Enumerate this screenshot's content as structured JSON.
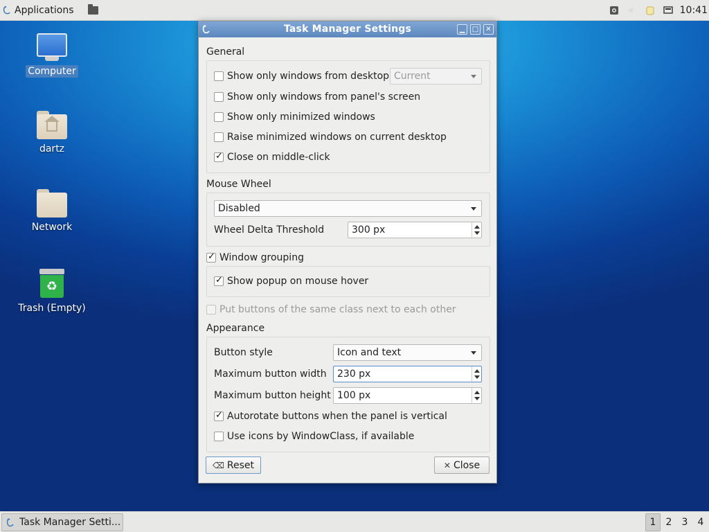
{
  "top_panel": {
    "applications_label": "Applications",
    "clock": "10:41"
  },
  "desktop": {
    "icons": [
      {
        "label": "Computer",
        "icon": "computer-icon",
        "selected": true
      },
      {
        "label": "dartz",
        "icon": "home-folder-icon"
      },
      {
        "label": "Network",
        "icon": "folder-icon"
      },
      {
        "label": "Trash (Empty)",
        "icon": "trash-icon"
      }
    ]
  },
  "dialog": {
    "title": "Task Manager Settings",
    "general": {
      "heading": "General",
      "show_windows_desktop": {
        "label": "Show only windows from desktop",
        "checked": false
      },
      "desktop_combo": "Current",
      "show_windows_screen": {
        "label": "Show only windows from panel's screen",
        "checked": false
      },
      "show_minimized": {
        "label": "Show only minimized windows",
        "checked": false
      },
      "raise_minimized": {
        "label": "Raise minimized windows on current desktop",
        "checked": false
      },
      "close_middle_click": {
        "label": "Close on middle-click",
        "checked": true
      }
    },
    "mouse_wheel": {
      "heading": "Mouse Wheel",
      "mode": "Disabled",
      "threshold_label": "Wheel Delta Threshold",
      "threshold_value": "300 px"
    },
    "window_grouping": {
      "label": "Window grouping",
      "checked": true,
      "popup_hover": {
        "label": "Show popup on mouse hover",
        "checked": true
      }
    },
    "same_class": {
      "label": "Put buttons of the same class next to each other",
      "checked": false,
      "disabled": true
    },
    "appearance": {
      "heading": "Appearance",
      "button_style_label": "Button style",
      "button_style_value": "Icon and text",
      "max_width_label": "Maximum button width",
      "max_width_value": "230 px",
      "max_height_label": "Maximum button height",
      "max_height_value": "100 px",
      "autorotate": {
        "label": "Autorotate buttons when the panel is vertical",
        "checked": true
      },
      "use_icons": {
        "label": "Use icons by WindowClass, if available",
        "checked": false
      }
    },
    "buttons": {
      "reset": "Reset",
      "close": "Close"
    }
  },
  "bottom_panel": {
    "task_label": "Task Manager Setti...",
    "workspaces": [
      "1",
      "2",
      "3",
      "4"
    ],
    "active_workspace": "1"
  },
  "colors": {
    "titlebar": "#6a93c8",
    "desktop_accent": "#1a8fd6",
    "panel": "#e8e8e7"
  }
}
